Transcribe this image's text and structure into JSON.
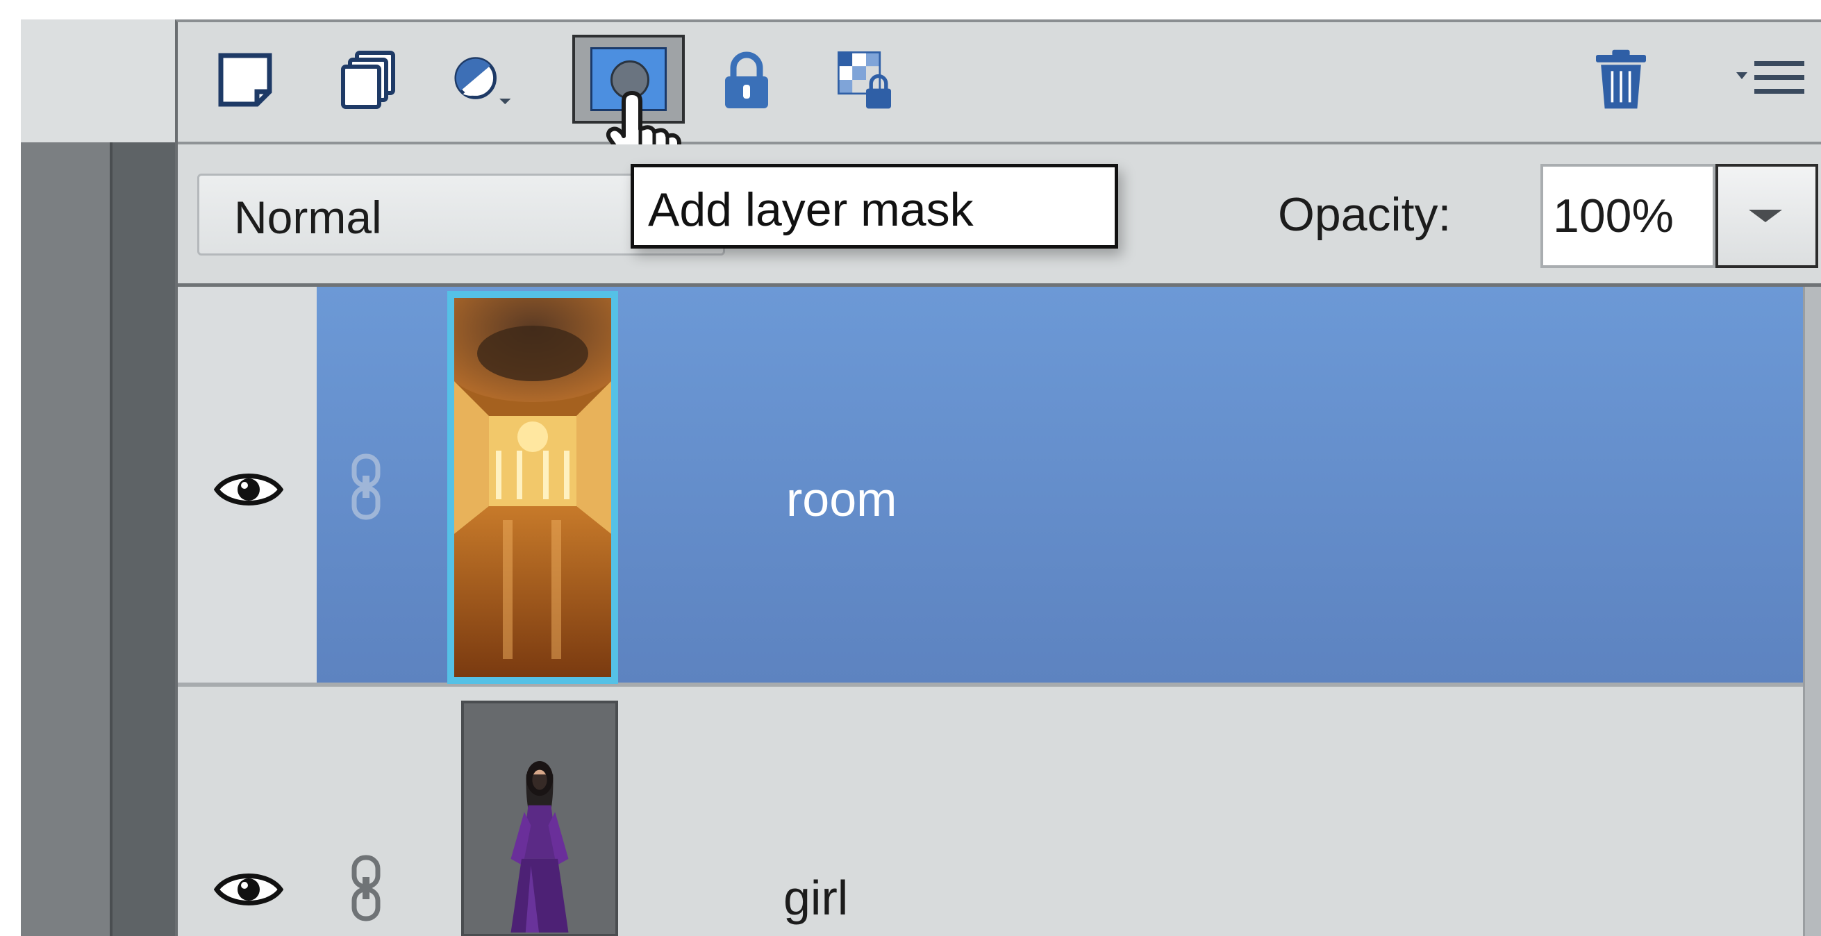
{
  "toolbar": {
    "icons": [
      "new-layer-icon",
      "new-group-icon",
      "adjustment-layer-icon",
      "layer-mask-icon",
      "lock-all-icon",
      "lock-transparency-icon",
      "delete-layer-icon",
      "panel-menu-icon"
    ]
  },
  "blend_mode": {
    "value": "Normal"
  },
  "tooltip": {
    "text": "Add layer mask"
  },
  "opacity": {
    "label": "Opacity:",
    "value": "100%"
  },
  "layers": [
    {
      "name": "room",
      "selected": true,
      "visible": true
    },
    {
      "name": "girl",
      "selected": false,
      "visible": true
    }
  ],
  "colors": {
    "selection": "#6a95d2",
    "panel": "#d8dbdc",
    "thumb_highlight": "#55c1e6"
  }
}
